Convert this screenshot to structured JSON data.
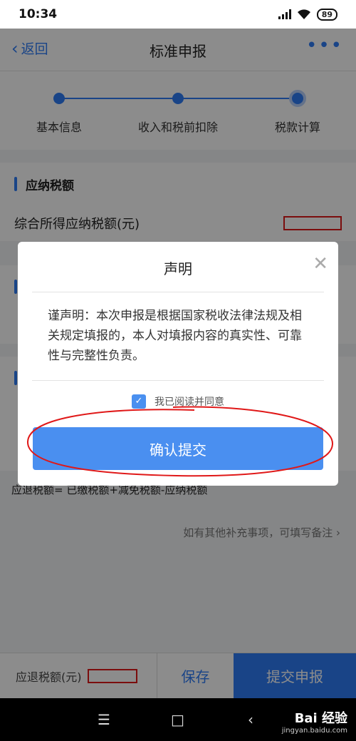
{
  "status": {
    "time": "10:34",
    "battery": "89"
  },
  "nav": {
    "back_label": "返回",
    "title": "标准申报",
    "more": "•••"
  },
  "steps": [
    {
      "label": "基本信息"
    },
    {
      "label": "收入和税前扣除"
    },
    {
      "label": "税款计算"
    }
  ],
  "section1": {
    "title": "应纳税额",
    "row_label": "综合所得应纳税额(元)"
  },
  "formula": "应退税额= 已缴税额+减免税额-应纳税额",
  "note": "如有其他补充事项，可填写备注",
  "bottom": {
    "refund_label": "应退税额(元)",
    "save": "保存",
    "submit": "提交申报"
  },
  "modal": {
    "title": "声明",
    "body": "谨声明：本次申报是根据国家税收法律法规及相关规定填报的，本人对填报内容的真实性、可靠性与完整性负责。",
    "agree_label": "我已阅读并同意",
    "agree_checked": true,
    "confirm": "确认提交"
  },
  "watermark": {
    "main": "Bai 经验",
    "sub": "jingyan.baidu.com"
  },
  "colors": {
    "accent": "#2f7cf6",
    "annotation_red": "#e01818"
  }
}
